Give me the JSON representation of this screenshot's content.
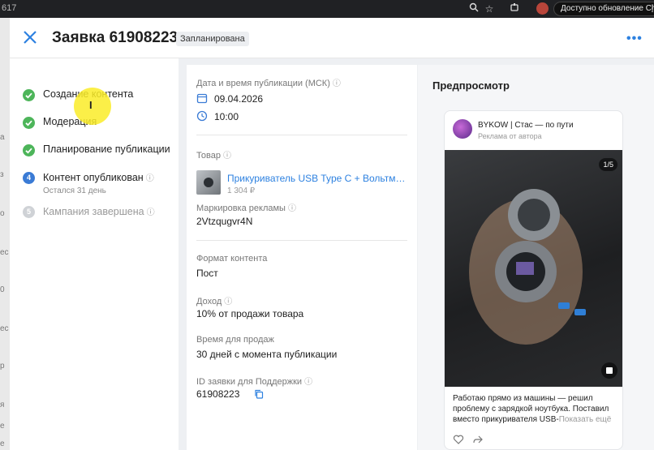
{
  "chrome": {
    "tab_fragment": "617",
    "update_text": "Доступно обновление Chrome"
  },
  "bg_page": {
    "fragments": [
      "з",
      "а",
      "о",
      "ес",
      "0",
      "ес",
      "р",
      "я",
      "е",
      "е"
    ]
  },
  "modal": {
    "title": "Заявка 61908223",
    "status": "Запланирована"
  },
  "steps": [
    {
      "label": "Создание контента",
      "state": "done"
    },
    {
      "label": "Модерация",
      "state": "done"
    },
    {
      "label": "Планирование публикации",
      "state": "done"
    },
    {
      "label": "Контент опубликован",
      "state": "current",
      "number": "4",
      "sub": "Остался 31 день"
    },
    {
      "label": "Кампания завершена",
      "state": "todo",
      "number": "5"
    }
  ],
  "details": {
    "publish_label": "Дата и время публикации (МСК)",
    "publish_date": "09.04.2026",
    "publish_time": "10:00",
    "product_label": "Товар",
    "product_name": "Прикуриватель USB Type C + Вольтметр",
    "product_price": "1 304 ₽",
    "ad_marking_label": "Маркировка рекламы",
    "ad_marking_value": "2Vtzqugvr4N",
    "format_label": "Формат контента",
    "format_value": "Пост",
    "income_label": "Доход",
    "income_value": "10% от продажи товара",
    "sales_time_label": "Время для продаж",
    "sales_time_value": "30 дней с момента публикации",
    "support_id_label": "ID заявки для Поддержки",
    "support_id_value": "61908223"
  },
  "preview": {
    "title": "Предпросмотр",
    "author": "BYKOW | Стас — по пути",
    "author_sub": "Реклама от автора",
    "image_counter": "1/5",
    "text": "Работаю прямо из машины — решил проблему с зарядкой ноутбука. Поставил вместо прикуривателя USB-",
    "more": "Показать ещё"
  },
  "icons": {
    "close": "close-icon",
    "more": "more-horizontal-icon",
    "done": "check-icon",
    "help": "help-circle-icon",
    "calendar": "calendar-icon",
    "clock": "clock-icon",
    "copy": "copy-icon",
    "like": "heart-icon",
    "share": "share-icon",
    "bag": "shopping-bag-icon"
  },
  "colors": {
    "accent": "#2d81e0",
    "done": "#4db55a",
    "current": "#3a7bd5",
    "todo": "#cfd2d6"
  }
}
